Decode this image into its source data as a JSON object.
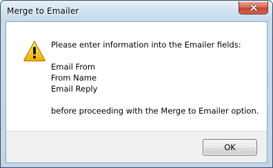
{
  "window": {
    "title": "Merge to Emailer",
    "title_bar_color": "#c6d8ed",
    "close_icon": "close-icon"
  },
  "dialog": {
    "icon": "warning-icon",
    "message_intro": "Please enter information into the Emailer fields:",
    "fields": [
      "Email From",
      "From Name",
      "Email Reply"
    ],
    "message_outro": "before proceeding with the Merge to Emailer option."
  },
  "buttons": {
    "ok_label": "OK"
  },
  "colors": {
    "close_button": "#c24530",
    "warning_fill": "#f4c22b",
    "button_bar": "#f0f0f0"
  }
}
